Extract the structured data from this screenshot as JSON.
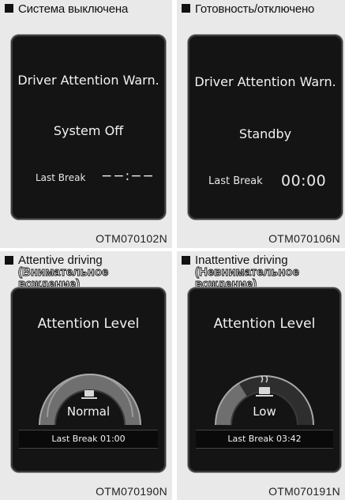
{
  "panels": [
    {
      "caption": "Система выключена",
      "title": "Driver Attention Warn.",
      "status": "System Off",
      "last_break_label": "Last Break",
      "last_break_value": "−−:−−",
      "code": "OTM070102N"
    },
    {
      "caption": "Готовность/отключено",
      "title": "Driver Attention Warn.",
      "status": "Standby",
      "last_break_label": "Last Break",
      "last_break_value": "00:00",
      "code": "OTM070106N"
    },
    {
      "caption_lines": [
        "Attentive driving",
        "(Внимательное",
        "вождение)"
      ],
      "title": "Attention Level",
      "level": "Normal",
      "last_break": "Last Break 01:00",
      "code": "OTM070190N",
      "cup_icon": "coffee-cup-icon"
    },
    {
      "caption_lines": [
        "Inattentive driving",
        "(Невнимательное",
        "вождение)"
      ],
      "title": "Attention Level",
      "level": "Low",
      "last_break": "Last Break 03:42",
      "code": "OTM070191N",
      "cup_icon": "steaming-coffee-cup-icon"
    }
  ]
}
